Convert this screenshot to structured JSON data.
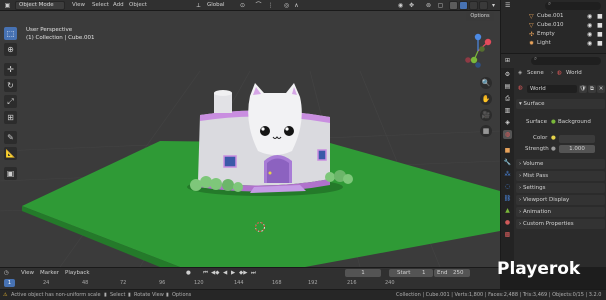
{
  "header": {
    "mode": "Object Mode",
    "menus": [
      "View",
      "Select",
      "Add",
      "Object"
    ],
    "transform_orientation": "Global",
    "options_label": "Options"
  },
  "viewport": {
    "view_name": "User Perspective",
    "collection_info": "(1) Collection | Cube.001"
  },
  "outliner": {
    "search_placeholder": "",
    "items": [
      {
        "label": "Cube.001",
        "icon": "mesh-icon",
        "color": "#e8a35b"
      },
      {
        "label": "Cube.010",
        "icon": "mesh-icon",
        "color": "#e8a35b"
      },
      {
        "label": "Empty",
        "icon": "empty-icon",
        "color": "#e8a35b"
      },
      {
        "label": "Light",
        "icon": "light-icon",
        "color": "#e8a35b"
      }
    ]
  },
  "properties": {
    "breadcrumb_scene": "Scene",
    "breadcrumb_world": "World",
    "world_name": "World",
    "surface_panel": "Surface",
    "surface_label": "Surface",
    "surface_value": "Background",
    "color_label": "Color",
    "strength_label": "Strength",
    "strength_value": "1.000",
    "panels": [
      "Volume",
      "Mist Pass",
      "Settings",
      "Viewport Display",
      "Animation",
      "Custom Properties"
    ]
  },
  "timeline": {
    "menus": [
      "View",
      "Marker",
      "Playback"
    ],
    "current_frame": "1",
    "start_label": "Start",
    "start_value": "1",
    "end_label": "End",
    "end_value": "250",
    "ticks": [
      "24",
      "48",
      "72",
      "96",
      "120",
      "144",
      "168",
      "192",
      "216",
      "240"
    ]
  },
  "statusbar": {
    "warning": "Active object has non-uniform scale",
    "hint_select": "Select",
    "hint_rotate": "Rotate View",
    "hint_options": "Options",
    "stats": "Collection | Cube.001 | Verts:1,800 | Faces:2,488 | Tris:3,469 | Objects:0/15 | 3.2.0"
  },
  "watermark": "Playerok",
  "colors": {
    "accent": "#4772b3",
    "ground": "#2f9a36",
    "house": "#d8d8dc",
    "trim": "#c98ee0"
  }
}
